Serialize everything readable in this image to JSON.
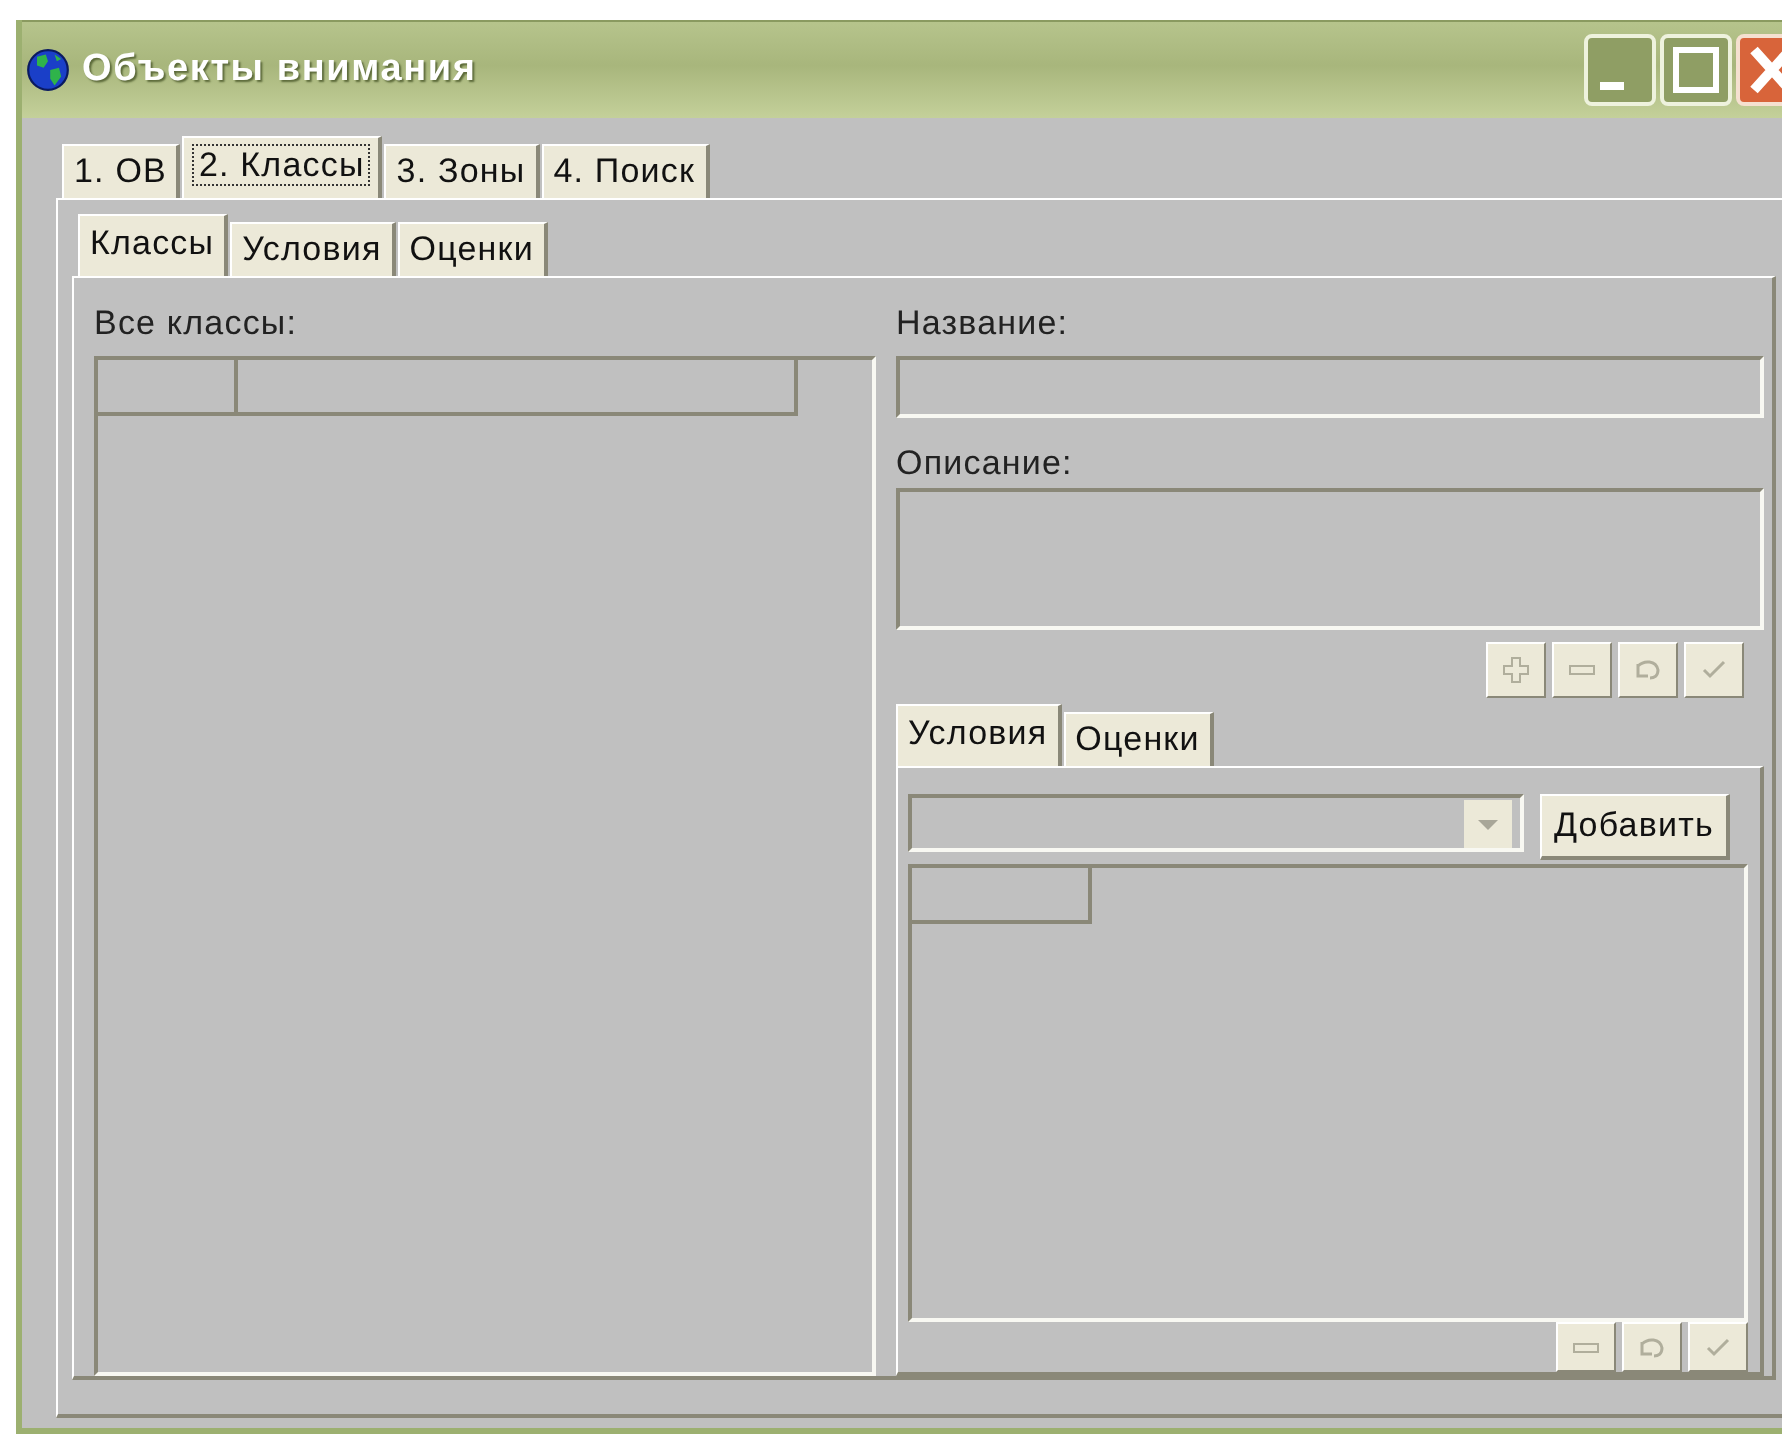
{
  "window": {
    "title": "Объекты внимания"
  },
  "tabs": [
    {
      "label": "1. ОВ",
      "selected": false
    },
    {
      "label": "2. Классы",
      "selected": true
    },
    {
      "label": "3. Зоны",
      "selected": false
    },
    {
      "label": "4. Поиск",
      "selected": false
    }
  ],
  "inner_tabs": [
    {
      "label": "Классы",
      "selected": true
    },
    {
      "label": "Условия",
      "selected": false
    },
    {
      "label": "Оценки",
      "selected": false
    }
  ],
  "classes_list": {
    "label": "Все классы:"
  },
  "name_field": {
    "label": "Название:"
  },
  "description_field": {
    "label": "Описание:"
  },
  "edit_buttons": [
    {
      "kind": "add",
      "disabled": true
    },
    {
      "kind": "remove",
      "disabled": true
    },
    {
      "kind": "undo",
      "disabled": true
    },
    {
      "kind": "apply",
      "disabled": true
    }
  ],
  "sub_tabs": [
    {
      "label": "Условия",
      "selected": true
    },
    {
      "label": "Оценки",
      "selected": false
    }
  ],
  "add_button": {
    "label": "Добавить"
  },
  "list_buttons": [
    {
      "kind": "remove",
      "disabled": true
    },
    {
      "kind": "undo",
      "disabled": true
    },
    {
      "kind": "apply",
      "disabled": true
    }
  ]
}
